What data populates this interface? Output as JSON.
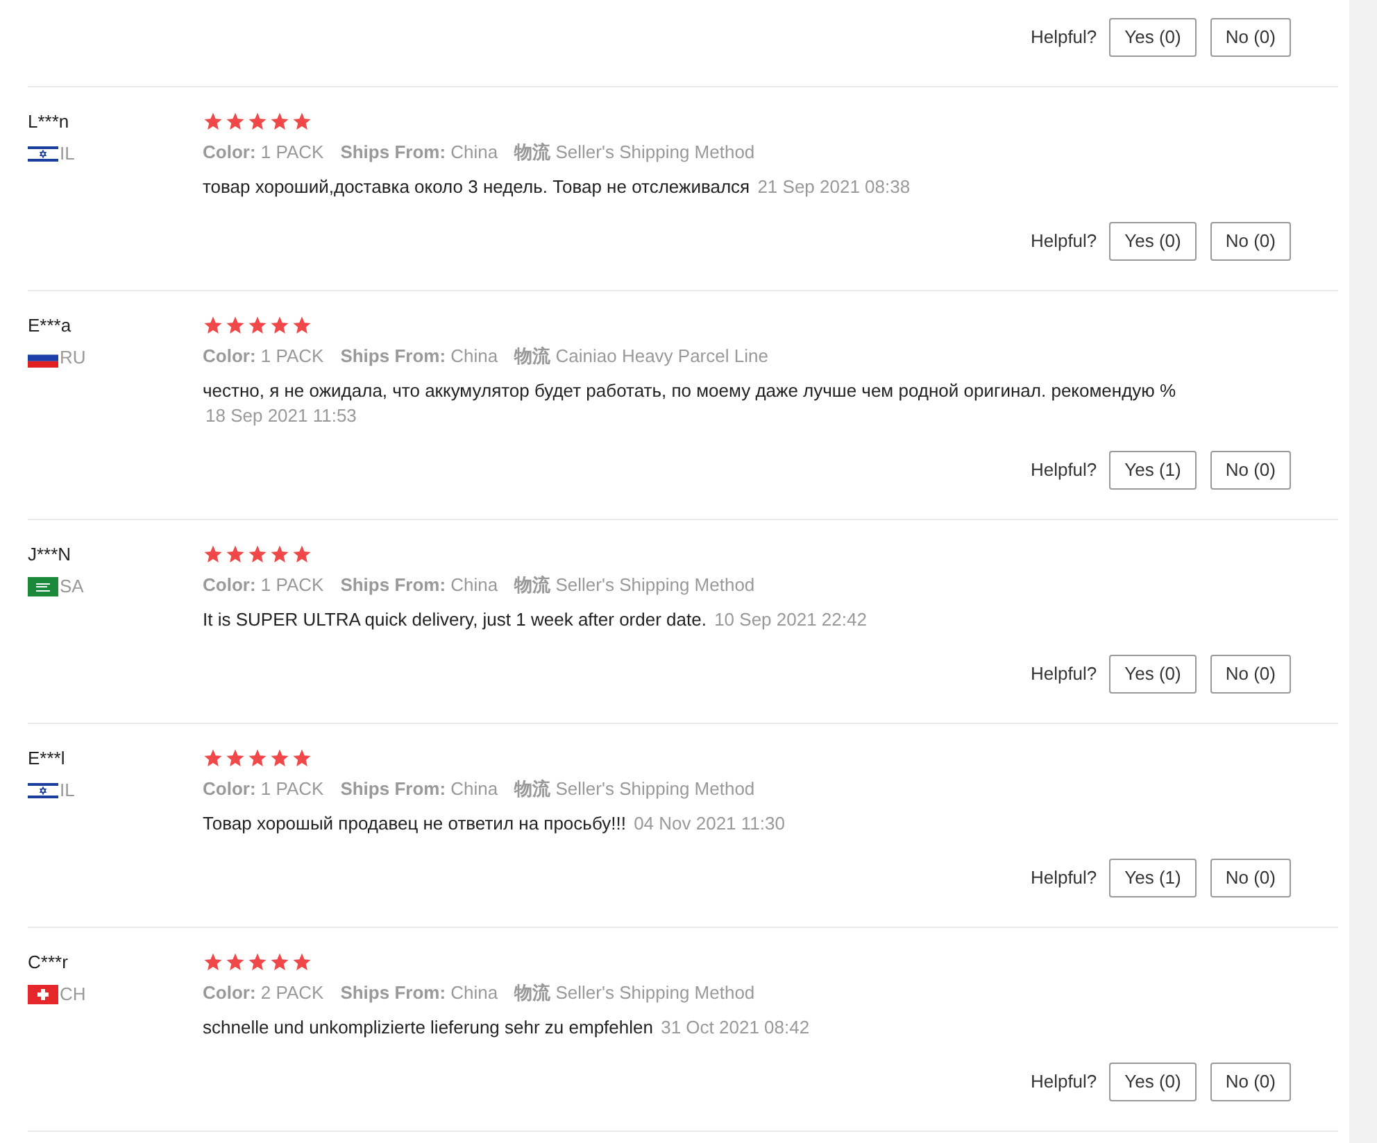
{
  "previous_feedback": {
    "label": "Helpful?",
    "yes": "Yes (0)",
    "no": "No (0)"
  },
  "reviews": [
    {
      "name": "L***n",
      "kind": "il",
      "country": "IL",
      "stars": 5,
      "attributes": [
        {
          "label": "Color:",
          "value": "1 PACK"
        },
        {
          "label": "Ships From:",
          "value": "China"
        },
        {
          "label": "物流",
          "value": "Seller's Shipping Method"
        }
      ],
      "text": "товар хороший,доставка около 3 недель. Товар не отслеживался",
      "date": "21 Sep 2021 08:38",
      "helpful": "Helpful?",
      "yes": "Yes (0)",
      "no": "No (0)"
    },
    {
      "name": "E***a",
      "kind": "ru",
      "country": "RU",
      "stars": 5,
      "attributes": [
        {
          "label": "Color:",
          "value": "1 PACK"
        },
        {
          "label": "Ships From:",
          "value": "China"
        },
        {
          "label": "物流",
          "value": "Cainiao Heavy Parcel Line"
        }
      ],
      "text": "честно, я не ожидала, что аккумулятор будет работать, по моему даже лучше чем родной оригинал. рекомендую %",
      "date": "18 Sep 2021 11:53",
      "helpful": "Helpful?",
      "yes": "Yes (1)",
      "no": "No (0)"
    },
    {
      "name": "J***N",
      "kind": "sa",
      "country": "SA",
      "stars": 5,
      "attributes": [
        {
          "label": "Color:",
          "value": "1 PACK"
        },
        {
          "label": "Ships From:",
          "value": "China"
        },
        {
          "label": "物流",
          "value": "Seller's Shipping Method"
        }
      ],
      "text": "It is SUPER ULTRA quick delivery, just 1 week after order date.",
      "date": "10 Sep 2021 22:42",
      "helpful": "Helpful?",
      "yes": "Yes (0)",
      "no": "No (0)"
    },
    {
      "name": "E***l",
      "kind": "il",
      "country": "IL",
      "stars": 5,
      "attributes": [
        {
          "label": "Color:",
          "value": "1 PACK"
        },
        {
          "label": "Ships From:",
          "value": "China"
        },
        {
          "label": "物流",
          "value": "Seller's Shipping Method"
        }
      ],
      "text": "Товар хорошый продавец не ответил на просьбу!!!",
      "date": "04 Nov 2021 11:30",
      "helpful": "Helpful?",
      "yes": "Yes (1)",
      "no": "No (0)"
    },
    {
      "name": "C***r",
      "kind": "ch",
      "country": "CH",
      "stars": 5,
      "attributes": [
        {
          "label": "Color:",
          "value": "2 PACK"
        },
        {
          "label": "Ships From:",
          "value": "China"
        },
        {
          "label": "物流",
          "value": "Seller's Shipping Method"
        }
      ],
      "text": "schnelle und unkomplizierte lieferung sehr zu empfehlen",
      "date": "31 Oct 2021 08:42",
      "helpful": "Helpful?",
      "yes": "Yes (0)",
      "no": "No (0)"
    }
  ]
}
